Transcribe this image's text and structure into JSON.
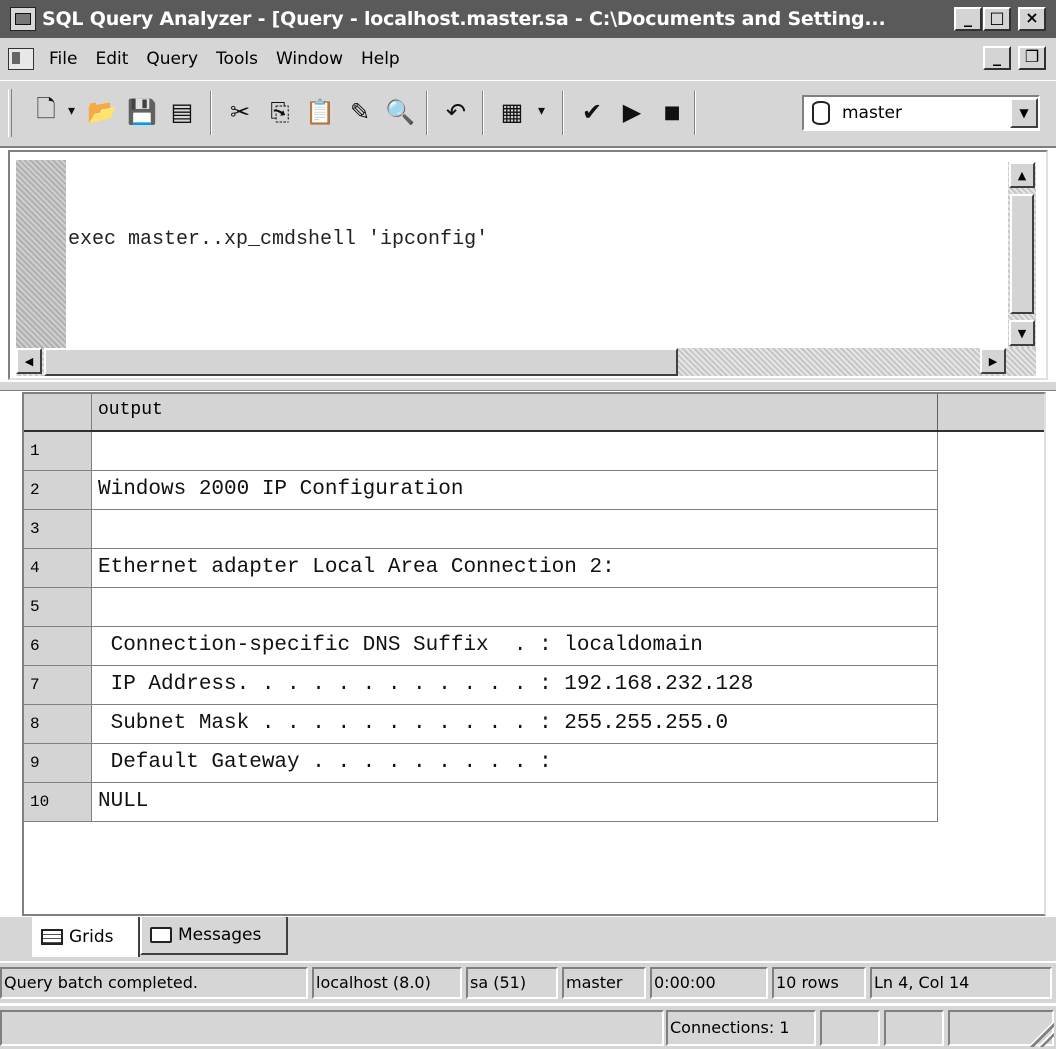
{
  "window": {
    "title": "SQL Query Analyzer - [Query - localhost.master.sa - C:\\Documents and Setting...",
    "minimize": "_",
    "maximize": "□",
    "close": "×",
    "doc_minimize": "_",
    "doc_restore": "❐",
    "doc_close": "×"
  },
  "menu": {
    "items": [
      "File",
      "Edit",
      "Query",
      "Tools",
      "Window",
      "Help"
    ]
  },
  "toolbar": {
    "buttons": [
      {
        "name": "new-query-icon",
        "glyph": "🗋"
      },
      {
        "name": "dropdown-arrow-icon",
        "glyph": "▾"
      },
      {
        "name": "open-folder-icon",
        "glyph": "📂"
      },
      {
        "name": "save-icon",
        "glyph": "💾"
      },
      {
        "name": "insert-template-icon",
        "glyph": "▤"
      },
      {
        "name": "cut-icon",
        "glyph": "✂"
      },
      {
        "name": "copy-icon",
        "glyph": "⎘"
      },
      {
        "name": "paste-icon",
        "glyph": "📋"
      },
      {
        "name": "clear-window-icon",
        "glyph": "✎"
      },
      {
        "name": "find-icon",
        "glyph": "🔍"
      },
      {
        "name": "undo-icon",
        "glyph": "↶"
      },
      {
        "name": "results-mode-icon",
        "glyph": "▦"
      },
      {
        "name": "parse-query-icon",
        "glyph": "✔"
      },
      {
        "name": "execute-query-icon",
        "glyph": "▶"
      },
      {
        "name": "cancel-query-icon",
        "glyph": "■"
      }
    ],
    "database": "master"
  },
  "editor": {
    "query": "exec master..xp_cmdshell 'ipconfig'"
  },
  "results": {
    "column": "output",
    "rows": [
      {
        "n": "1",
        "value": ""
      },
      {
        "n": "2",
        "value": "Windows 2000 IP Configuration"
      },
      {
        "n": "3",
        "value": ""
      },
      {
        "n": "4",
        "value": "Ethernet adapter Local Area Connection 2:"
      },
      {
        "n": "5",
        "value": ""
      },
      {
        "n": "6",
        "value": " Connection-specific DNS Suffix  . : localdomain"
      },
      {
        "n": "7",
        "value": " IP Address. . . . . . . . . . . . : 192.168.232.128"
      },
      {
        "n": "8",
        "value": " Subnet Mask . . . . . . . . . . . : 255.255.255.0"
      },
      {
        "n": "9",
        "value": " Default Gateway . . . . . . . . . :"
      },
      {
        "n": "10",
        "value": "NULL"
      }
    ]
  },
  "tabs": {
    "grids": "Grids",
    "messages": "Messages"
  },
  "status": {
    "message": "Query batch completed.",
    "server": "localhost (8.0)",
    "user": "sa (51)",
    "database": "master",
    "elapsed": "0:00:00",
    "rows": "10 rows",
    "position": "Ln 4, Col 14",
    "connections": "Connections: 1"
  }
}
